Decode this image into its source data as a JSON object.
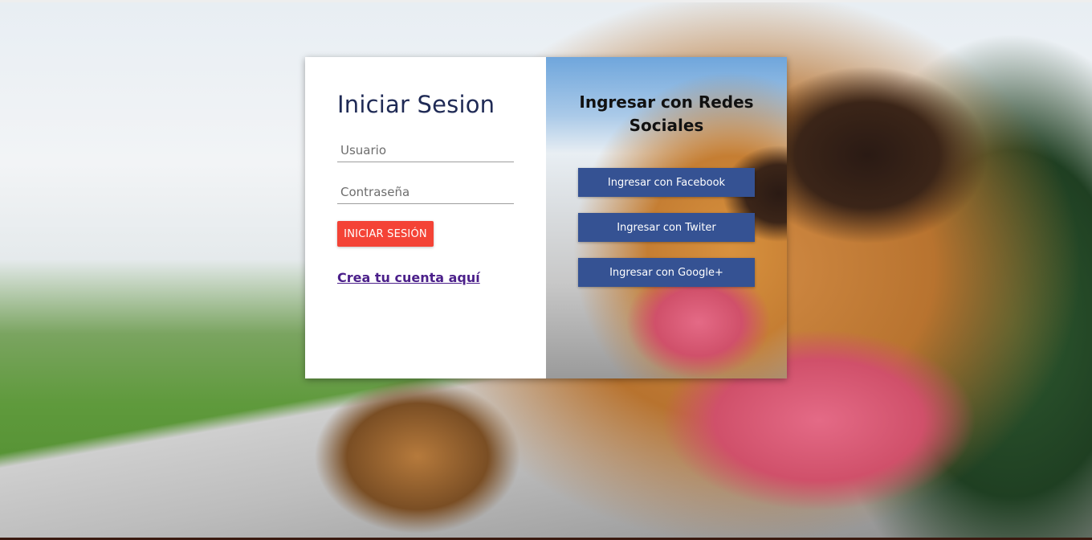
{
  "login": {
    "title": "Iniciar Sesion",
    "username_placeholder": "Usuario",
    "password_placeholder": "Contraseña",
    "submit_label": "INICIAR SESIÓN",
    "create_account_link": "Crea tu cuenta aquí"
  },
  "social": {
    "title": "Ingresar con Redes Sociales",
    "buttons": [
      {
        "label": "Ingresar con Facebook"
      },
      {
        "label": "Ingresar con Twiter"
      },
      {
        "label": "Ingresar con Google+"
      }
    ]
  },
  "colors": {
    "primary_button": "#f44336",
    "social_button": "#355293",
    "title_text": "#1f2a55",
    "link": "#4b1f8a"
  }
}
